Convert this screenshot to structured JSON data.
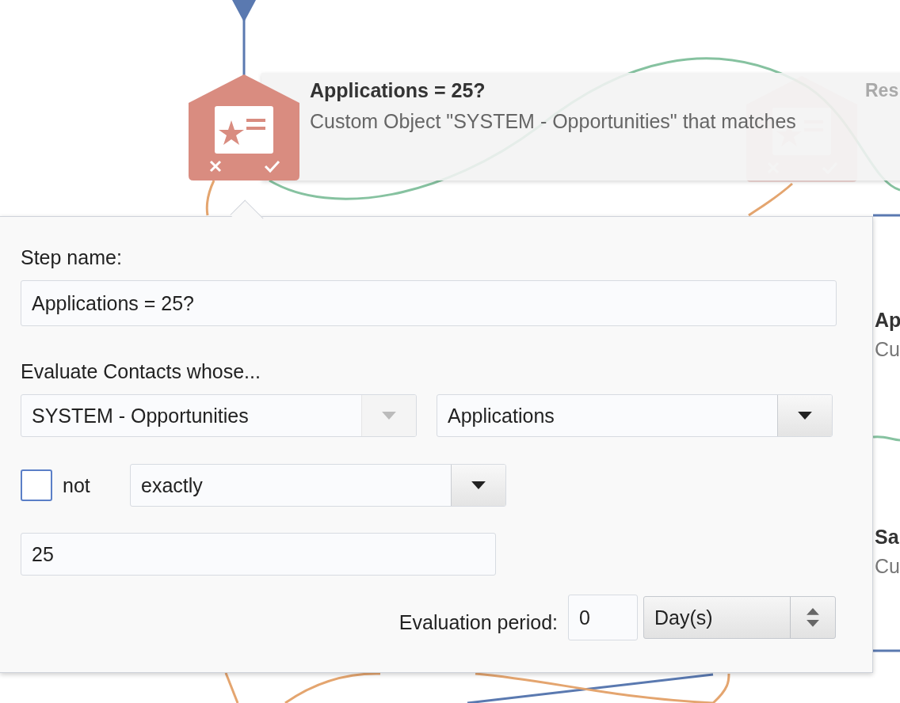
{
  "flow": {
    "hover_card": {
      "title": "Applications = 25?",
      "description": "Custom Object \"SYSTEM - Opportunities\" that matches"
    },
    "faded_node": {
      "title": "Res"
    },
    "side_nodes": [
      {
        "title": "Ap",
        "subtitle": "Cu"
      },
      {
        "title": "Sa",
        "subtitle": "Cu"
      }
    ]
  },
  "panel": {
    "step_name": {
      "label": "Step name:",
      "value": "Applications = 25?"
    },
    "evaluate": {
      "label": "Evaluate Contacts whose...",
      "object_select": {
        "value": "SYSTEM - Opportunities",
        "disabled": true
      },
      "field_select": {
        "value": "Applications",
        "disabled": false
      }
    },
    "negate": {
      "label": "not",
      "checked": false
    },
    "operator_select": {
      "value": "exactly",
      "disabled": false
    },
    "value_field": {
      "value": "25"
    },
    "evaluation_period": {
      "label": "Evaluation period:",
      "amount": "0",
      "unit": "Day(s)"
    }
  }
}
